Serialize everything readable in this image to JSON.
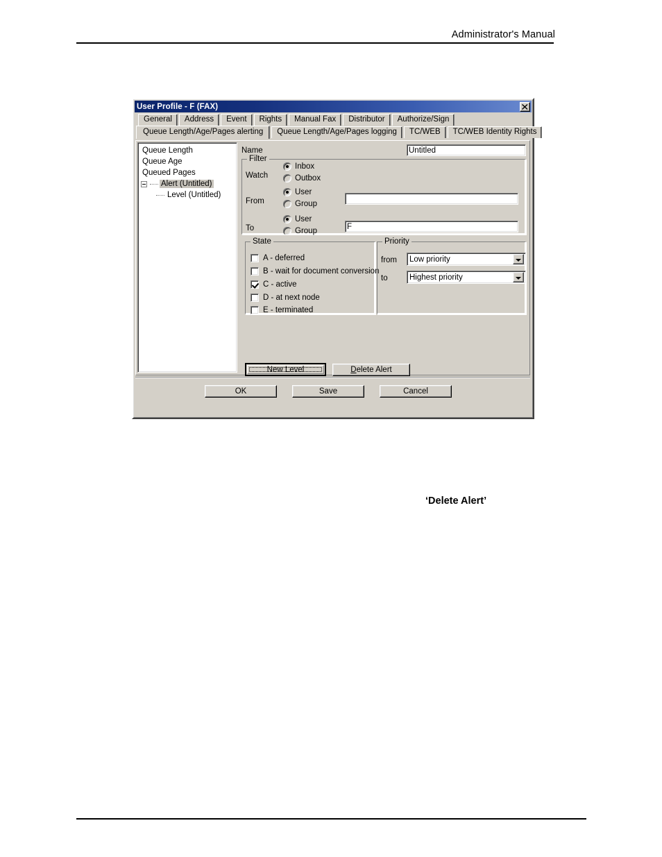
{
  "page": {
    "header_text": "Administrator's Manual",
    "body_note": "‘Delete Alert’"
  },
  "dialog": {
    "title": "User Profile - F (FAX)",
    "close_icon": "close-icon",
    "tabs_row1": [
      {
        "label": "General"
      },
      {
        "label": "Address"
      },
      {
        "label": "Event"
      },
      {
        "label": "Rights"
      },
      {
        "label": "Manual Fax"
      },
      {
        "label": "Distributor"
      },
      {
        "label": "Authorize/Sign"
      }
    ],
    "tabs_row2": [
      {
        "label": "Queue Length/Age/Pages alerting",
        "selected": true
      },
      {
        "label": "Queue Length/Age/Pages logging",
        "selected": false
      },
      {
        "label": "TC/WEB",
        "selected": false
      },
      {
        "label": "TC/WEB Identity Rights",
        "selected": false
      }
    ],
    "tree": {
      "nodes": [
        {
          "label": "Queue Length",
          "level": 1,
          "selected": false
        },
        {
          "label": "Queue Age",
          "level": 1,
          "selected": false
        },
        {
          "label": "Queued Pages",
          "level": 1,
          "selected": false
        },
        {
          "label": "Alert (Untitled)",
          "level": 2,
          "selected": true
        },
        {
          "label": "Level (Untitled)",
          "level": 3,
          "selected": false
        }
      ]
    },
    "form": {
      "name_label": "Name",
      "name_value": "Untitled",
      "filter_group": "Filter",
      "watch_label": "Watch",
      "watch_inbox": "Inbox",
      "watch_outbox": "Outbox",
      "from_label": "From",
      "from_user": "User",
      "from_group": "Group",
      "from_value": "",
      "to_label": "To",
      "to_user": "User",
      "to_group": "Group",
      "to_value": "F",
      "state_group": "State",
      "state_items": [
        {
          "label": "A - deferred",
          "checked": false
        },
        {
          "label": "B - wait for document conversion",
          "checked": false
        },
        {
          "label": "C - active",
          "checked": true
        },
        {
          "label": "D - at next node",
          "checked": false
        },
        {
          "label": "E - terminated",
          "checked": false
        }
      ],
      "priority_group": "Priority",
      "priority_from_label": "from",
      "priority_from_value": "Low priority",
      "priority_to_label": "to",
      "priority_to_value": "Highest priority"
    },
    "actions": {
      "new_level": "New Level",
      "delete_alert_pre": "D",
      "delete_alert_post": "elete Alert",
      "ok": "OK",
      "save": "Save",
      "cancel": "Cancel"
    }
  }
}
